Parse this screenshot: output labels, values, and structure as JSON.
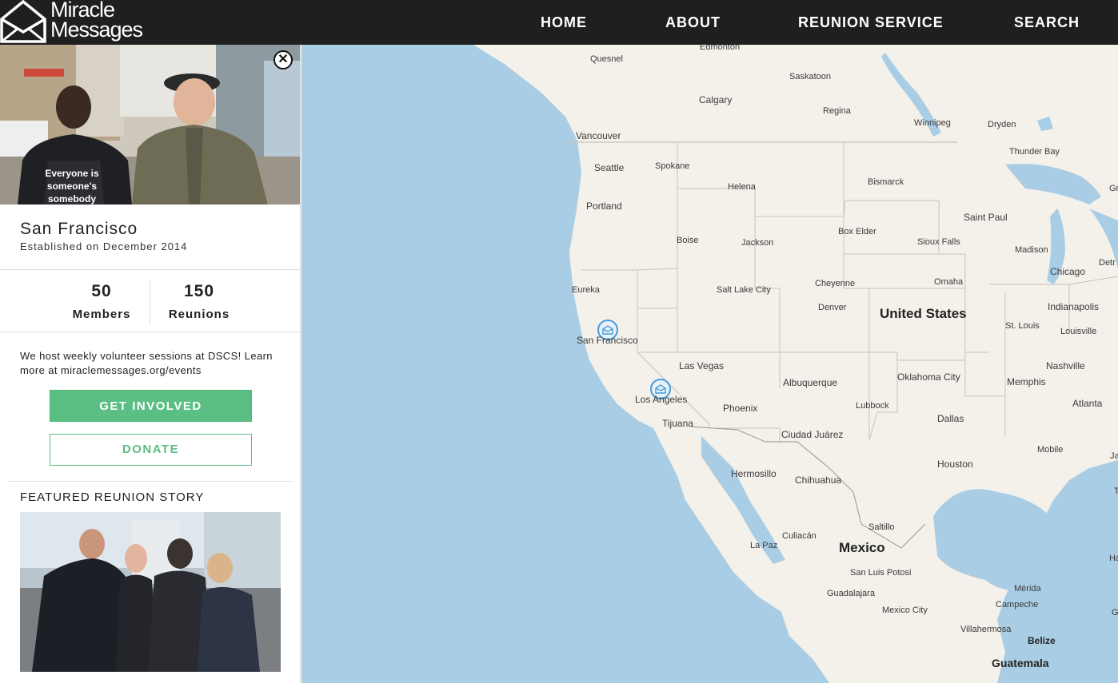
{
  "header": {
    "logo_line1": "Miracle",
    "logo_line2": "Messages",
    "nav": {
      "home": "HOME",
      "about": "ABOUT",
      "reunion_service": "REUNION SERVICE",
      "search": "SEARCH"
    }
  },
  "sidebar": {
    "city": "San Francisco",
    "established": "Established on December 2014",
    "stats": {
      "members_value": "50",
      "members_label": "Members",
      "reunions_value": "150",
      "reunions_label": "Reunions"
    },
    "blurb": "We host weekly volunteer sessions at DSCS! Learn more at miraclemessages.org/events",
    "get_involved": "GET INVOLVED",
    "donate": "DONATE",
    "featured_title": "FEATURED REUNION STORY",
    "hero_shirt_text": [
      "Everyone is",
      "someone's",
      "somebody"
    ]
  },
  "map": {
    "labels": {
      "edmonton": "Edmonton",
      "quesnel": "Quesnel",
      "saskatoon": "Saskatoon",
      "calgary": "Calgary",
      "regina": "Regina",
      "winnipeg": "Winnipeg",
      "dryden": "Dryden",
      "vancouver": "Vancouver",
      "thunder_bay": "Thunder Bay",
      "seattle": "Seattle",
      "spokane": "Spokane",
      "helena": "Helena",
      "bismarck": "Bismarck",
      "portland": "Portland",
      "saint_paul": "Saint Paul",
      "boise": "Boise",
      "jackson": "Jackson",
      "box_elder": "Box Elder",
      "sioux_falls": "Sioux Falls",
      "madison": "Madison",
      "chicago": "Chicago",
      "eureka": "Eureka",
      "salt_lake_city": "Salt Lake City",
      "cheyenne": "Cheyenne",
      "omaha": "Omaha",
      "united_states": "United States",
      "denver": "Denver",
      "indianapolis": "Indianapolis",
      "st_louis": "St. Louis",
      "louisville": "Louisville",
      "san_francisco": "San Francisco",
      "las_vegas": "Las Vegas",
      "nashville": "Nashville",
      "oklahoma_city": "Oklahoma City",
      "albuquerque": "Albuquerque",
      "memphis": "Memphis",
      "los_angeles": "Los Angeles",
      "atlanta": "Atlanta",
      "lubbock": "Lubbock",
      "phoenix": "Phoenix",
      "dallas": "Dallas",
      "tijuana": "Tijuana",
      "ciudad_juarez": "Ciudad Juárez",
      "mobile": "Mobile",
      "houston": "Houston",
      "hermosillo": "Hermosillo",
      "chihuahua": "Chihuahua",
      "saltillo": "Saltillo",
      "culiacan": "Culiacán",
      "la_paz": "La Paz",
      "mexico": "Mexico",
      "san_luis_potosi": "San Luis Potosi",
      "guadalajara": "Guadalajara",
      "merida": "Mérida",
      "campeche": "Campeche",
      "mexico_city": "Mexico City",
      "villahermosa": "Villahermosa",
      "belize": "Belize",
      "guatemala": "Guatemala",
      "detroit": "Detr",
      "gr": "Gr",
      "jac": "Jac",
      "ta": "Ta",
      "ha": "Ha",
      "go": "Go"
    }
  },
  "colors": {
    "nav_bg": "#1f1f1f",
    "accent_green": "#5bbf83",
    "water": "#a9cde4",
    "land": "#f4f1ea",
    "marker_blue": "#4a9bd8"
  },
  "icons": {
    "logo": "envelope-house-icon",
    "close": "close-icon",
    "marker": "envelope-marker-icon"
  }
}
